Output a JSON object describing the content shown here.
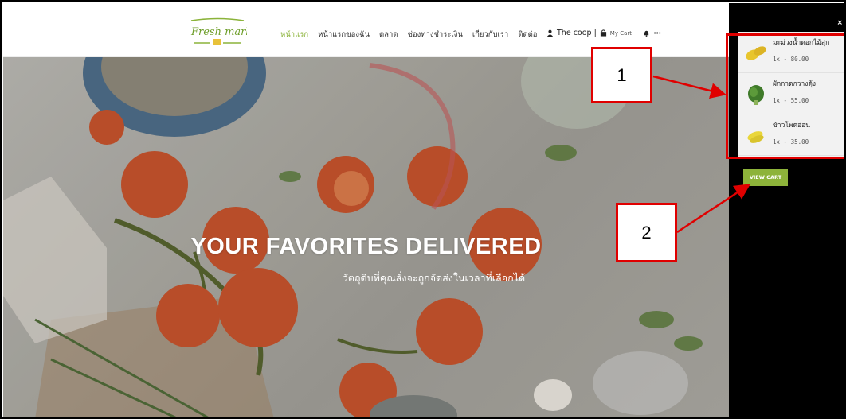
{
  "header": {
    "logo_text": "Fresh market",
    "nav": [
      {
        "label": "หน้าแรก",
        "active": true
      },
      {
        "label": "หน้าแรกของฉัน",
        "active": false
      },
      {
        "label": "ตลาด",
        "active": false
      },
      {
        "label": "ช่องทางชำระเงิน",
        "active": false
      },
      {
        "label": "เกี่ยวกับเรา",
        "active": false
      },
      {
        "label": "ติดต่อ",
        "active": false
      }
    ],
    "user_label": "The coop |",
    "cart_label": "My Cart",
    "user_icon": "user-icon",
    "cart_icon": "bag-icon",
    "bell_icon": "bell-icon",
    "more_icon": "more-icon",
    "more_label": "•••",
    "accent": "#8bb33a"
  },
  "hero": {
    "title": "YOUR FAVORITES DELIVERED",
    "subtitle": "วัตถุดิบที่คุณสั่งจะถูกจัดส่งในเวลาที่เลือกได้"
  },
  "sidepanel": {
    "close_label": "×",
    "cart_items": [
      {
        "name": "มะม่วงน้ำดอกไม้สุก",
        "qty_price": "1x - 80.00",
        "icon": "mango-icon"
      },
      {
        "name": "ผักกาดกวางตุ้ง",
        "qty_price": "1x - 55.00",
        "icon": "greens-icon"
      },
      {
        "name": "ข้าวโพดอ่อน",
        "qty_price": "1x - 35.00",
        "icon": "corn-icon"
      }
    ],
    "view_cart_label": "VIEW CART"
  },
  "annotations": {
    "callout_1": "1",
    "callout_2": "2",
    "color": "#e00000"
  }
}
